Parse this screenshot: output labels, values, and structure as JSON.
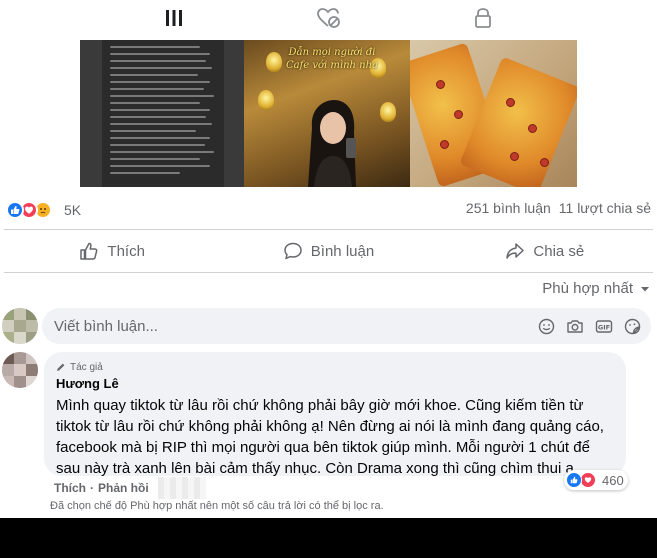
{
  "tabs": [
    {
      "icon": "grid-icon"
    },
    {
      "icon": "hidden-heart-icon"
    },
    {
      "icon": "lock-icon"
    }
  ],
  "media": {
    "cafe_caption": "Dẫn mọi người đi Cafe với mình nha"
  },
  "reactions": {
    "count": "5K",
    "types": [
      "like",
      "love",
      "care"
    ],
    "colors": {
      "like": "#1877f2",
      "love": "#f33e58",
      "care": "#f7b125"
    }
  },
  "stats": {
    "comments": "251 bình luận",
    "shares": "11 lượt chia sẻ"
  },
  "actions": {
    "like": "Thích",
    "comment": "Bình luận",
    "share": "Chia sẻ"
  },
  "sort": {
    "label": "Phù hợp nhất"
  },
  "composer": {
    "placeholder": "Viết bình luận..."
  },
  "comment": {
    "badge": "Tác giả",
    "author": "Hương Lê",
    "text": "Mình quay tiktok từ lâu rồi chứ không phải bây giờ mới khoe. Cũng kiếm tiền từ tiktok từ lâu rồi chứ không phải không ạ! Nên đừng ai nói là mình đang quảng cáo, facebook mà bị RIP thì mọi người qua bên tiktok giúp mình. Mỗi người 1 chút để sau này trà xanh lên bài cảm thấy nhục. Còn Drama xong thì cũng chìm thui ạ",
    "reaction_count": "460",
    "like_link": "Thích",
    "separator": "·",
    "reply_link": "Phản hồi"
  },
  "filter_note": "Đã chọn chế độ Phù hợp nhất nên một số câu trả lời có thể bị lọc ra."
}
